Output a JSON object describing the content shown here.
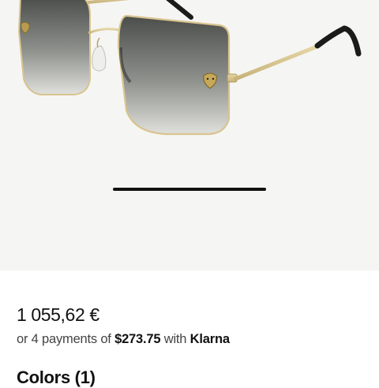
{
  "product": {
    "image_alt": "Gold metal square sunglasses with grey gradient lenses",
    "price": "1 055,62 €",
    "installments": {
      "prefix": "or 4 payments of",
      "amount": "$273.75",
      "middle": "with",
      "provider": "Klarna"
    },
    "colors_heading": "Colors (1)"
  },
  "gallery": {
    "current_slide": 1
  },
  "colors": {
    "gallery_bg": "#f5f5f3",
    "frame_gold": "#d8c48f",
    "lens_dark": "#4a4d4a",
    "lens_light": "#e0e0dc"
  }
}
